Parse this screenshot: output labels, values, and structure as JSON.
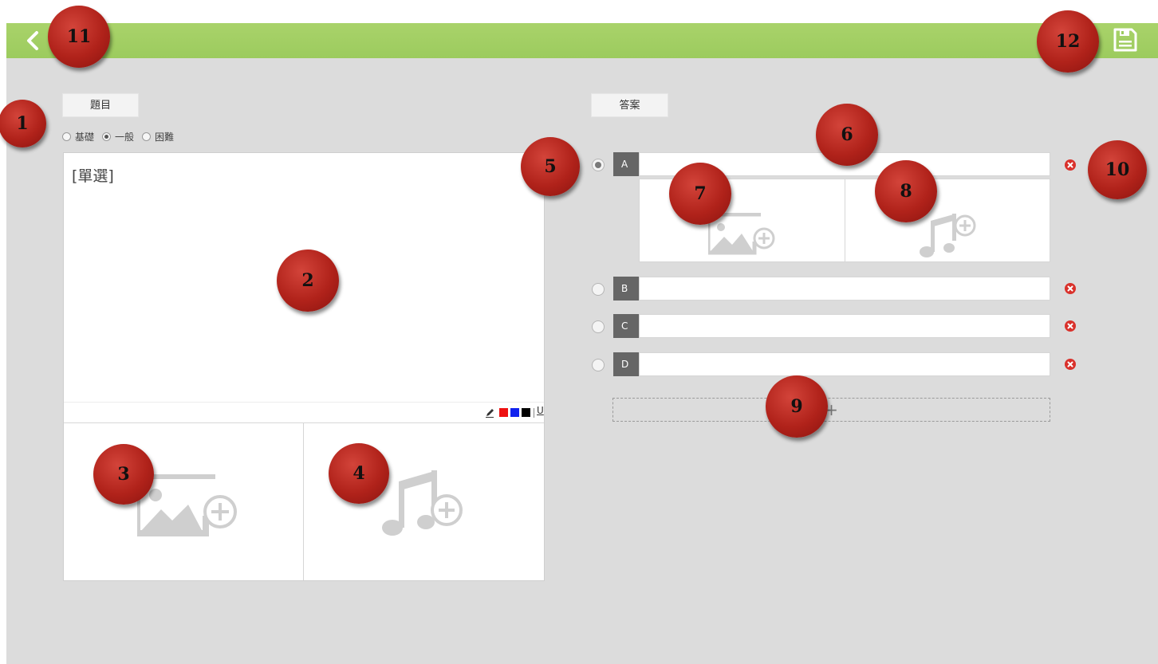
{
  "question_tab": {
    "label": "題目"
  },
  "answer_tab": {
    "label": "答案"
  },
  "difficulty": {
    "options": [
      "基礎",
      "一般",
      "困難"
    ],
    "selected": "一般"
  },
  "question": {
    "text": "[單選]"
  },
  "editor_toolbar": {
    "tools": [
      "pencil-icon",
      "red-color",
      "blue-color",
      "black-color",
      "underline-icon"
    ],
    "colors": {
      "red": "#ee1111",
      "blue": "#1122ee",
      "black": "#000000"
    },
    "underline_label": "U"
  },
  "answers": {
    "options": [
      {
        "letter": "A",
        "value": "",
        "selected": true
      },
      {
        "letter": "B",
        "value": "",
        "selected": false
      },
      {
        "letter": "C",
        "value": "",
        "selected": false
      },
      {
        "letter": "D",
        "value": "",
        "selected": false
      }
    ],
    "add_label": "+"
  },
  "badges": [
    "1",
    "2",
    "3",
    "4",
    "5",
    "6",
    "7",
    "8",
    "9",
    "10",
    "11",
    "12"
  ],
  "colors": {
    "topbar": "#a4cf64",
    "background": "#dcdcdc",
    "badge": "#b0221a",
    "delete": "#d9312b"
  }
}
